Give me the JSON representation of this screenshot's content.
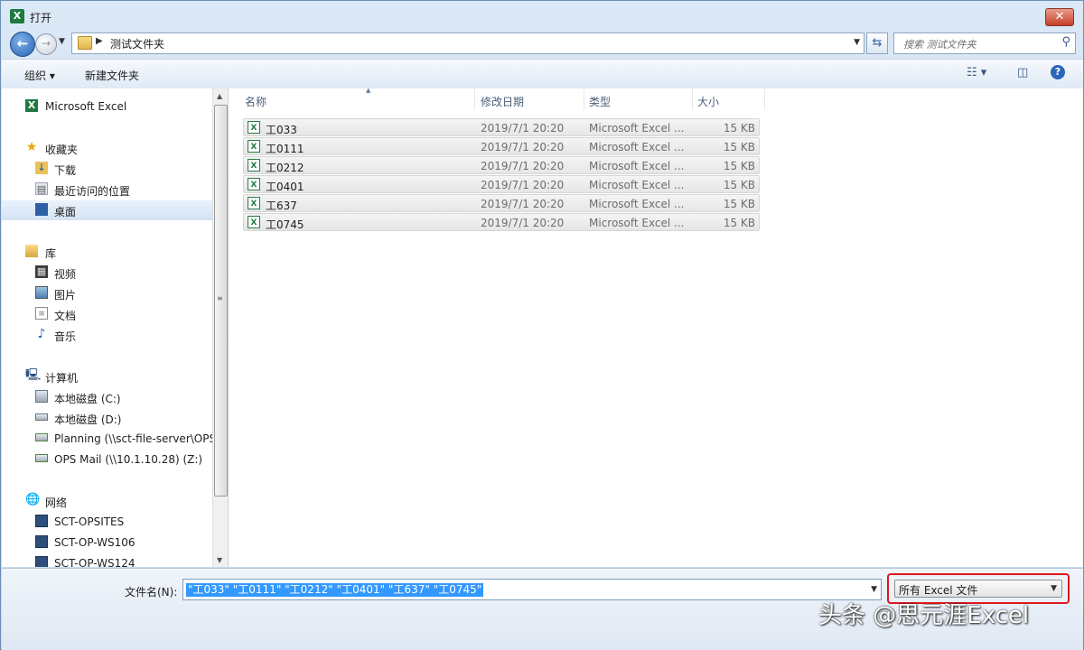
{
  "window": {
    "title": "打开",
    "close_glyph": "✕"
  },
  "address": {
    "path": "测试文件夹",
    "search_placeholder": "搜索 测试文件夹"
  },
  "toolbar": {
    "organize": "组织 ▾",
    "new_folder": "新建文件夹",
    "help": "?"
  },
  "nav": {
    "items": [
      {
        "label": "Microsoft Excel",
        "icon": "excel-icon"
      },
      {
        "label": "收藏夹",
        "icon": "star-icon"
      },
      {
        "label": "下载",
        "icon": "download-folder-icon"
      },
      {
        "label": "最近访问的位置",
        "icon": "recent-places-icon"
      },
      {
        "label": "桌面",
        "icon": "desktop-icon",
        "selected": true
      },
      {
        "label": "库",
        "icon": "library-icon"
      },
      {
        "label": "视频",
        "icon": "video-icon"
      },
      {
        "label": "图片",
        "icon": "picture-icon"
      },
      {
        "label": "文档",
        "icon": "document-icon"
      },
      {
        "label": "音乐",
        "icon": "music-icon"
      },
      {
        "label": "计算机",
        "icon": "computer-icon"
      },
      {
        "label": "本地磁盘 (C:)",
        "icon": "local-disk-c-icon"
      },
      {
        "label": "本地磁盘 (D:)",
        "icon": "local-disk-d-icon"
      },
      {
        "label": "Planning (\\\\sct-file-server\\OPS",
        "icon": "network-drive-icon"
      },
      {
        "label": "OPS Mail (\\\\10.1.10.28) (Z:)",
        "icon": "network-drive-icon"
      },
      {
        "label": "网络",
        "icon": "network-icon"
      },
      {
        "label": "SCT-OPSITES",
        "icon": "network-computer-icon"
      },
      {
        "label": "SCT-OP-WS106",
        "icon": "network-computer-icon"
      },
      {
        "label": "SCT-OP-WS124",
        "icon": "network-computer-icon"
      }
    ]
  },
  "columns": {
    "name": "名称",
    "date": "修改日期",
    "type": "类型",
    "size": "大小"
  },
  "files": [
    {
      "name": "工033",
      "date": "2019/7/1 20:20",
      "type": "Microsoft Excel ...",
      "size": "15 KB"
    },
    {
      "name": "工0111",
      "date": "2019/7/1 20:20",
      "type": "Microsoft Excel ...",
      "size": "15 KB"
    },
    {
      "name": "工0212",
      "date": "2019/7/1 20:20",
      "type": "Microsoft Excel ...",
      "size": "15 KB"
    },
    {
      "name": "工0401",
      "date": "2019/7/1 20:20",
      "type": "Microsoft Excel ...",
      "size": "15 KB"
    },
    {
      "name": "工637",
      "date": "2019/7/1 20:20",
      "type": "Microsoft Excel ...",
      "size": "15 KB"
    },
    {
      "name": "工0745",
      "date": "2019/7/1 20:20",
      "type": "Microsoft Excel ...",
      "size": "15 KB"
    }
  ],
  "filename": {
    "label": "文件名(N):",
    "value": "\"工033\" \"工0111\" \"工0212\" \"工0401\" \"工637\" \"工0745\""
  },
  "filetype": {
    "value": "所有 Excel 文件"
  },
  "watermark": "头条 @思元涯Excel",
  "colors": {
    "selection": "#3399ff",
    "highlight_outline": "#e0161e",
    "excel_green": "#1f7a3d"
  }
}
